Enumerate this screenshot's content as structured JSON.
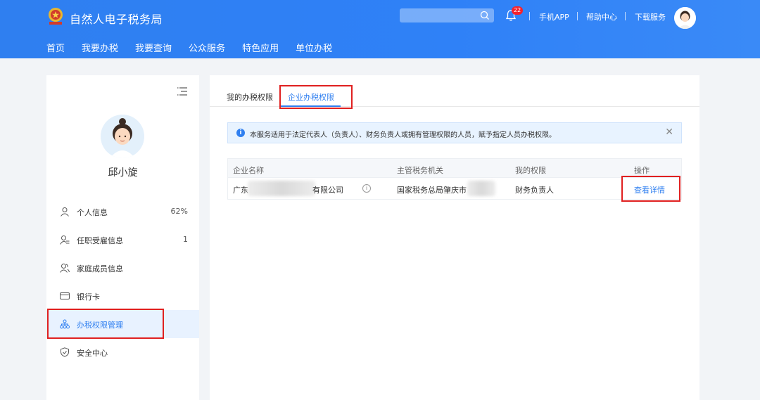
{
  "header": {
    "app_title": "自然人电子税务局",
    "notification_count": "22",
    "links": {
      "mobile_app": "手机APP",
      "help_center": "帮助中心",
      "download": "下载服务"
    }
  },
  "nav": {
    "items": [
      "首页",
      "我要办税",
      "我要查询",
      "公众服务",
      "特色应用",
      "单位办税"
    ]
  },
  "sidebar": {
    "user_name": "邱小旋",
    "items": [
      {
        "label": "个人信息",
        "count": "62%",
        "icon": "person-icon"
      },
      {
        "label": "任职受雇信息",
        "count": "1",
        "icon": "person-list-icon"
      },
      {
        "label": "家庭成员信息",
        "count": "",
        "icon": "family-icon"
      },
      {
        "label": "银行卡",
        "count": "",
        "icon": "bank-card-icon"
      },
      {
        "label": "办税权限管理",
        "count": "",
        "icon": "org-tree-icon",
        "active": true
      },
      {
        "label": "安全中心",
        "count": "",
        "icon": "shield-icon"
      }
    ]
  },
  "main": {
    "tabs": [
      {
        "label": "我的办税权限",
        "active": false
      },
      {
        "label": "企业办税权限",
        "active": true
      }
    ],
    "notice": "本服务适用于法定代表人（负责人）、财务负责人或拥有管理权限的人员，赋予指定人员办税权限。",
    "table": {
      "headers": [
        "企业名称",
        "主管税务机关",
        "我的权限",
        "操作"
      ],
      "rows": [
        {
          "company_prefix": "广东",
          "company_suffix": "有限公司",
          "tax_authority": "国家税务总局肇庆市",
          "permission": "财务负责人",
          "action": "查看详情"
        }
      ]
    }
  },
  "colors": {
    "brand": "#2f7ff0",
    "highlight": "#e02020",
    "badge": "#f5222d"
  }
}
